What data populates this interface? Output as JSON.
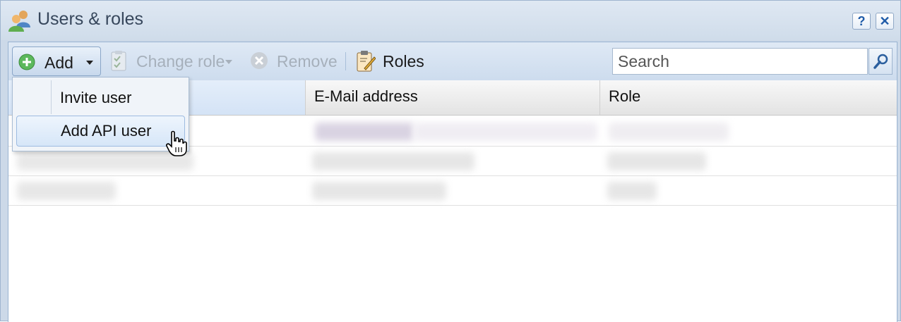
{
  "window": {
    "title": "Users & roles"
  },
  "titlebar_buttons": {
    "help": "?",
    "close": "✕"
  },
  "toolbar": {
    "add_label": "Add",
    "change_role_label": "Change role",
    "remove_label": "Remove",
    "roles_label": "Roles"
  },
  "search": {
    "placeholder": "Search",
    "value": ""
  },
  "table": {
    "columns": [
      "",
      "E-Mail address",
      "Role"
    ],
    "rows_obscured": 3
  },
  "add_menu": {
    "items": [
      {
        "label": "Invite user",
        "highlighted": false
      },
      {
        "label": "Add API user",
        "highlighted": true
      }
    ]
  },
  "colors": {
    "window_bg": "#ccd9e8",
    "toolbar_bg": "#d6e2f1",
    "accent_green": "#4caf50",
    "accent_blue": "#1f5ba8"
  },
  "icons": {
    "title": "users-icon",
    "add": "add-circle-icon",
    "change_role": "clipboard-check-icon",
    "remove": "remove-circle-icon",
    "roles": "clipboard-pencil-icon",
    "search": "magnifier-icon"
  }
}
